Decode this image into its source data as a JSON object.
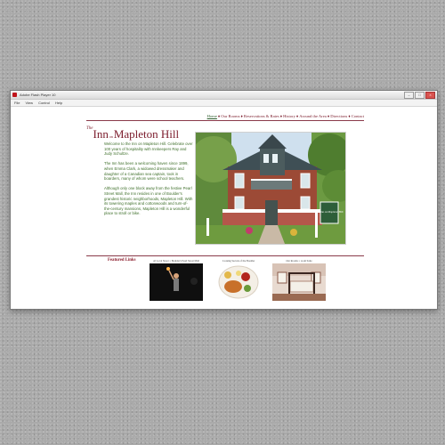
{
  "window": {
    "title": "Adobe Flash Player 10",
    "menu": [
      "File",
      "View",
      "Control",
      "Help"
    ]
  },
  "site": {
    "logo": {
      "the": "The",
      "inn": "Inn",
      "on": "on",
      "mapleton": "Mapleton Hill"
    },
    "nav": [
      {
        "label": "Home",
        "active": true
      },
      {
        "label": "Our Rooms",
        "active": false
      },
      {
        "label": "Reservations & Rates",
        "active": false
      },
      {
        "label": "History",
        "active": false
      },
      {
        "label": "Around the Area",
        "active": false
      },
      {
        "label": "Directions",
        "active": false
      },
      {
        "label": "Contact",
        "active": false
      }
    ],
    "intro": [
      "Welcome to the Inn on Mapleton Hill. Celebrate over 100 years of hospitality with Innkeepers Ray and Judy Schultze.",
      "The Inn has been a welcoming haven since 1899, when Emma Clark, a widowed dressmaker and daughter of a Canadian sea captain, took in boarders, many of whom were school teachers.",
      "Although only one block away from the festive Pearl Street Mall, the Inn resides in one of Boulder's grandest historic neighborhoods, Mapleton Hill. With its towering maples and cottonwoods and turn-of-the-century mansions, Mapleton Hill is a wonderful place to stroll or bike."
    ],
    "photo": {
      "sign_text": "The Inn on Mapleton Hill"
    },
    "featured": {
      "label": "Featured Links",
      "items": [
        {
          "caption": "Al Local Street = Boulder's Pearl Street Mall",
          "scene": "street-performer-night"
        },
        {
          "caption": "Cooking Secrets of the Boulder",
          "scene": "breakfast-plate"
        },
        {
          "caption": "Our Rooms = room Suite",
          "scene": "bedroom-suite"
        }
      ]
    }
  }
}
